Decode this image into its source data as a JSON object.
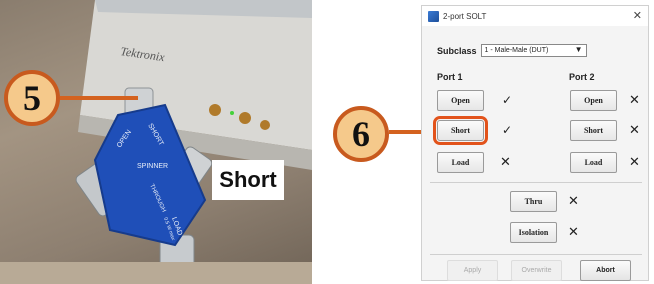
{
  "photo": {
    "label": "Short",
    "colors": {
      "bracket": "#d4621f",
      "calkit": "#1f4fb8"
    },
    "calkit": {
      "brand": "SPINNER",
      "port_labels": [
        "OPEN",
        "SHORT",
        "THROUGH",
        "LOAD"
      ],
      "load_rating": "0.5 W max"
    },
    "instrument_brand": "Tektronix"
  },
  "callouts": [
    {
      "number": "5"
    },
    {
      "number": "6"
    }
  ],
  "dialog": {
    "title": "2-port SOLT",
    "close_icon": "close-icon",
    "subclass_label": "Subclass",
    "subclass_value": "1 - Male-Male (DUT)",
    "port1": {
      "label": "Port 1",
      "rows": [
        {
          "button": "Open",
          "status": "✓"
        },
        {
          "button": "Short",
          "status": "✓"
        },
        {
          "button": "Load",
          "status": "✕"
        }
      ]
    },
    "port2": {
      "label": "Port 2",
      "rows": [
        {
          "button": "Open",
          "status": "✕"
        },
        {
          "button": "Short",
          "status": "✕"
        },
        {
          "button": "Load",
          "status": "✕"
        }
      ]
    },
    "thru": {
      "button": "Thru",
      "status": "✕"
    },
    "isolation": {
      "button": "Isolation",
      "status": "✕"
    },
    "footer": {
      "apply": "Apply",
      "overwrite": "Overwrite",
      "abort": "Abort"
    },
    "highlight_color": "#e2531b"
  }
}
